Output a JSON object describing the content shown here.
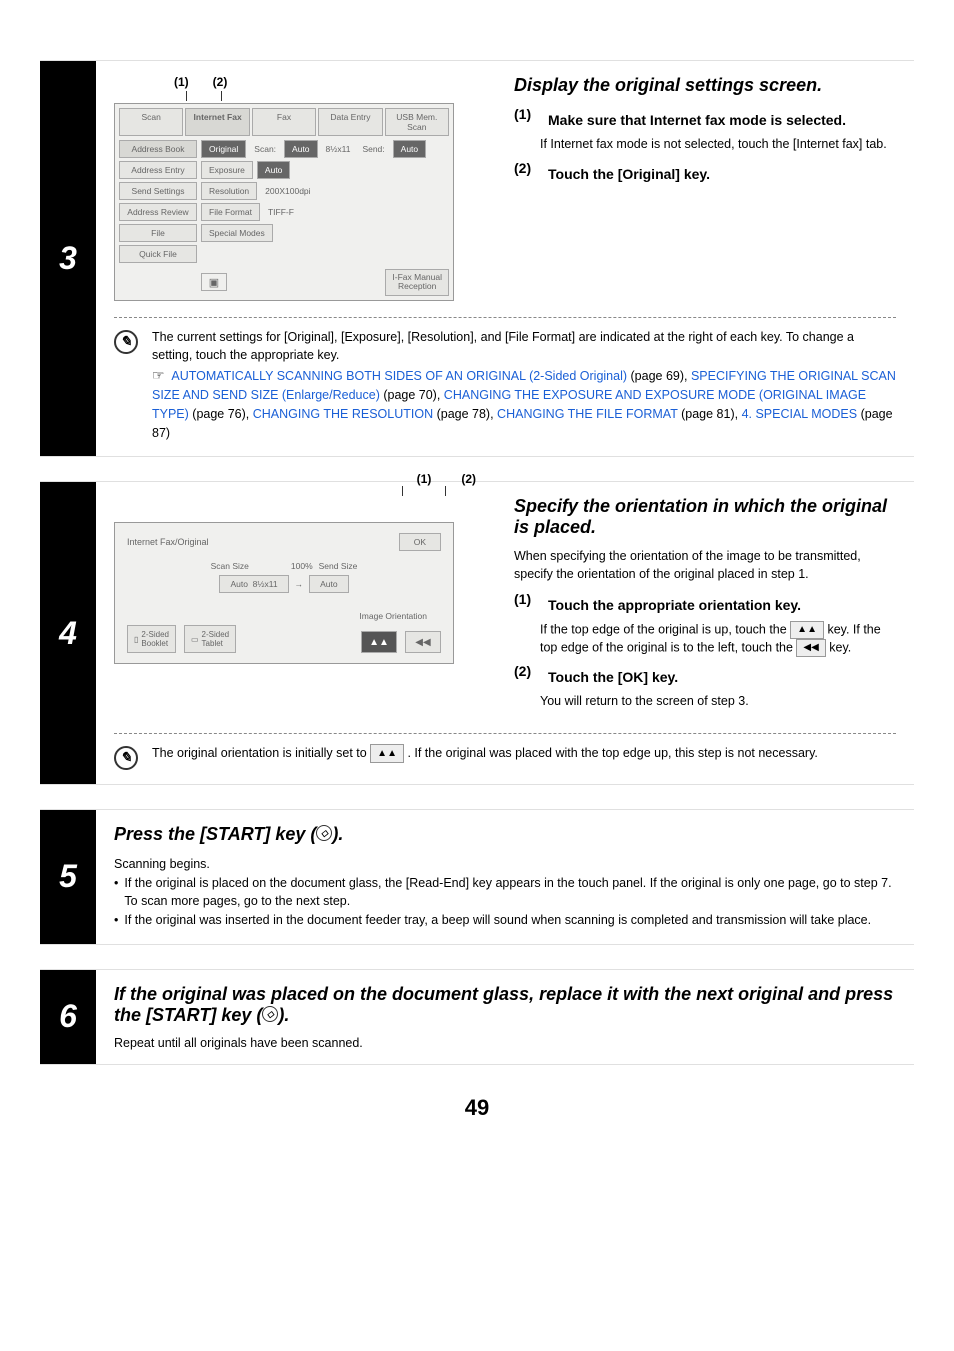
{
  "page_number": "49",
  "step3": {
    "number": "3",
    "callouts": [
      "(1)",
      "(2)"
    ],
    "panel": {
      "tabs": [
        "Scan",
        "Internet Fax",
        "Fax",
        "Data Entry",
        "USB Mem. Scan"
      ],
      "rows": [
        {
          "side": "Address Book",
          "btn": "Original",
          "label": "Scan:",
          "sz": "Auto",
          "paper": "8½x11",
          "label2": "Send:",
          "send": "Auto"
        },
        {
          "side": "Address Entry",
          "btn": "Exposure",
          "val": "Auto"
        },
        {
          "side": "Send Settings",
          "btn": "Resolution",
          "val": "200X100dpi"
        },
        {
          "side": "Address Review",
          "btn": "File Format",
          "val": "TIFF-F"
        },
        {
          "side": "File",
          "btn": "Special Modes"
        },
        {
          "side": "Quick File"
        }
      ],
      "bottom_btn": "I-Fax Manual\nReception"
    },
    "head": "Display the original settings screen.",
    "sub1_num": "(1)",
    "sub1_head": "Make sure that Internet fax mode is selected.",
    "sub1_desc": "If Internet fax mode is not selected, touch the [Internet fax] tab.",
    "sub2_num": "(2)",
    "sub2_head": "Touch the [Original] key.",
    "note_lead": "The current settings for [Original], [Exposure], [Resolution], and [File Format] are indicated at the right of each key. To change a setting, touch the appropriate key.",
    "note_hand": "☞",
    "note_links": [
      {
        "text": "AUTOMATICALLY SCANNING BOTH SIDES OF AN ORIGINAL (2-Sided Original)",
        "page": " (page 69), "
      },
      {
        "text": "SPECIFYING THE ORIGINAL SCAN SIZE AND SEND SIZE (Enlarge/Reduce)",
        "page": " (page 70), "
      },
      {
        "text": "CHANGING THE EXPOSURE AND EXPOSURE MODE (ORIGINAL IMAGE TYPE)",
        "page": " (page 76), "
      },
      {
        "text": "CHANGING THE RESOLUTION",
        "page": " (page 78), "
      },
      {
        "text": "CHANGING THE FILE FORMAT",
        "page": " (page 81), "
      },
      {
        "text": "4. SPECIAL MODES",
        "page": " (page 87)"
      }
    ]
  },
  "step4": {
    "number": "4",
    "callouts": [
      "(1)",
      "(2)"
    ],
    "panel": {
      "title": "Internet Fax/Original",
      "ok": "OK",
      "scan_label": "Scan Size",
      "ratio": "100%",
      "send_label": "Send Size",
      "auto": "Auto",
      "paper": "8½x11",
      "img_or": "Image Orientation",
      "sided": [
        "2-Sided\nBooklet",
        "2-Sided\nTablet"
      ],
      "orient_up": "▲▲",
      "orient_left": "◀◀"
    },
    "head": "Specify the orientation in which the original is placed.",
    "lead": "When specifying the orientation of the image to be transmitted, specify the orientation of the original placed in step 1.",
    "sub1_num": "(1)",
    "sub1_head": "Touch the appropriate orientation key.",
    "sub1_desc_a": "If the top edge of the original is up, touch the ",
    "sub1_desc_b": " key. If the top edge of the original is to the left, touch the ",
    "sub1_desc_c": " key.",
    "sub2_num": "(2)",
    "sub2_head": "Touch the [OK] key.",
    "sub2_desc": "You will return to the screen of step 3.",
    "note_a": "The original orientation is initially set to ",
    "note_b": " . If the original was placed with the top edge up, this step is not necessary."
  },
  "step5": {
    "number": "5",
    "head_a": "Press the [START] key (",
    "head_b": ").",
    "lead": "Scanning begins.",
    "b1": "If the original is placed on the document glass, the [Read-End] key appears in the touch panel. If the original is only one page, go to step 7. To scan more pages, go to the next step.",
    "b2": "If the original was inserted in the document feeder tray, a beep will sound when scanning is completed and transmission will take place."
  },
  "step6": {
    "number": "6",
    "head_a": "If the original was placed on the document glass, replace it with the next original and press the [START] key (",
    "head_b": ").",
    "lead": "Repeat until all originals have been scanned."
  }
}
